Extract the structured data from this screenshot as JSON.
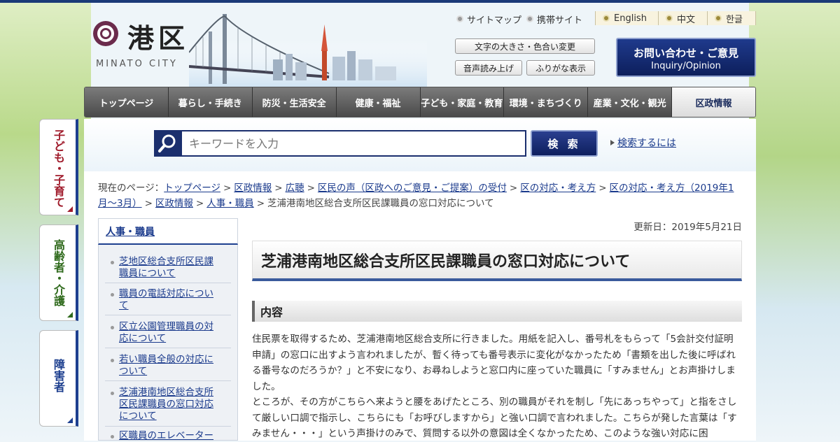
{
  "header": {
    "logo_text": "港区",
    "logo_sub": "MINATO CITY",
    "sitemap": "サイトマップ",
    "mobile": "携帯サイト",
    "languages": [
      "English",
      "中文",
      "한글"
    ],
    "font_size_btn": "文字の大きさ・色合い変更",
    "read_aloud_btn": "音声読み上げ",
    "furigana_btn": "ふりがな表示",
    "inquiry_line1": "お問い合わせ・ご意見",
    "inquiry_line2": "Inquiry/Opinion"
  },
  "nav": [
    "トップページ",
    "暮らし・手続き",
    "防災・生活安全",
    "健康・福祉",
    "子ども・家庭・教育",
    "環境・まちづくり",
    "産業・文化・観光",
    "区政情報"
  ],
  "side_tabs": [
    {
      "label": "子ども・子育て",
      "color": "#a01c2c"
    },
    {
      "label": "高齢者・介護",
      "color": "#2f6a1c"
    },
    {
      "label": "障害者",
      "color": "#1d3f8f"
    }
  ],
  "search": {
    "placeholder": "キーワードを入力",
    "button": "検 索",
    "howto": "検索するには"
  },
  "breadcrumb": {
    "prefix": "現在のページ：",
    "items": [
      "トップページ",
      "区政情報",
      "広聴",
      "区民の声（区政へのご意見・ご提案）の受付",
      "区の対応・考え方",
      "区の対応・考え方（2019年1月～3月）",
      "区政情報",
      "人事・職員"
    ],
    "current": "芝浦港南地区総合支所区民課職員の窓口対応について"
  },
  "subnav": {
    "title": "人事・職員",
    "items": [
      "芝地区総合支所区民課職員について",
      "職員の電話対応について",
      "区立公園管理職員の対応について",
      "若い職員全般の対応について",
      "芝浦港南地区総合支所区民課職員の窓口対応について",
      "区職員のエレベーター"
    ]
  },
  "main": {
    "updated": "更新日：2019年5月21日",
    "title": "芝浦港南地区総合支所区民課職員の窓口対応について",
    "section": "内容",
    "paragraph1": "住民票を取得するため、芝浦港南地区総合支所に行きました。用紙を記入し、番号札をもらって「5会計交付証明申請」の窓口に出すよう言われましたが、暫く待っても番号表示に変化がなかったため「書類を出した後に呼ばれる番号なのだろうか？」と不安になり、お尋ねしようと窓口内に座っていた職員に「すみません」とお声掛けしました。",
    "paragraph2": "ところが、その方がこちらへ来ようと腰をあげたところ、別の職員がそれを制し「先にあっちやって」と指をさして厳しい口調で指示し、こちらにも「お呼びしますから」と強い口調で言われました。こちらが発した言葉は「すみません・・・」という声掛けのみで、質問する以外の意図は全くなかったため、このような強い対応に困"
  }
}
